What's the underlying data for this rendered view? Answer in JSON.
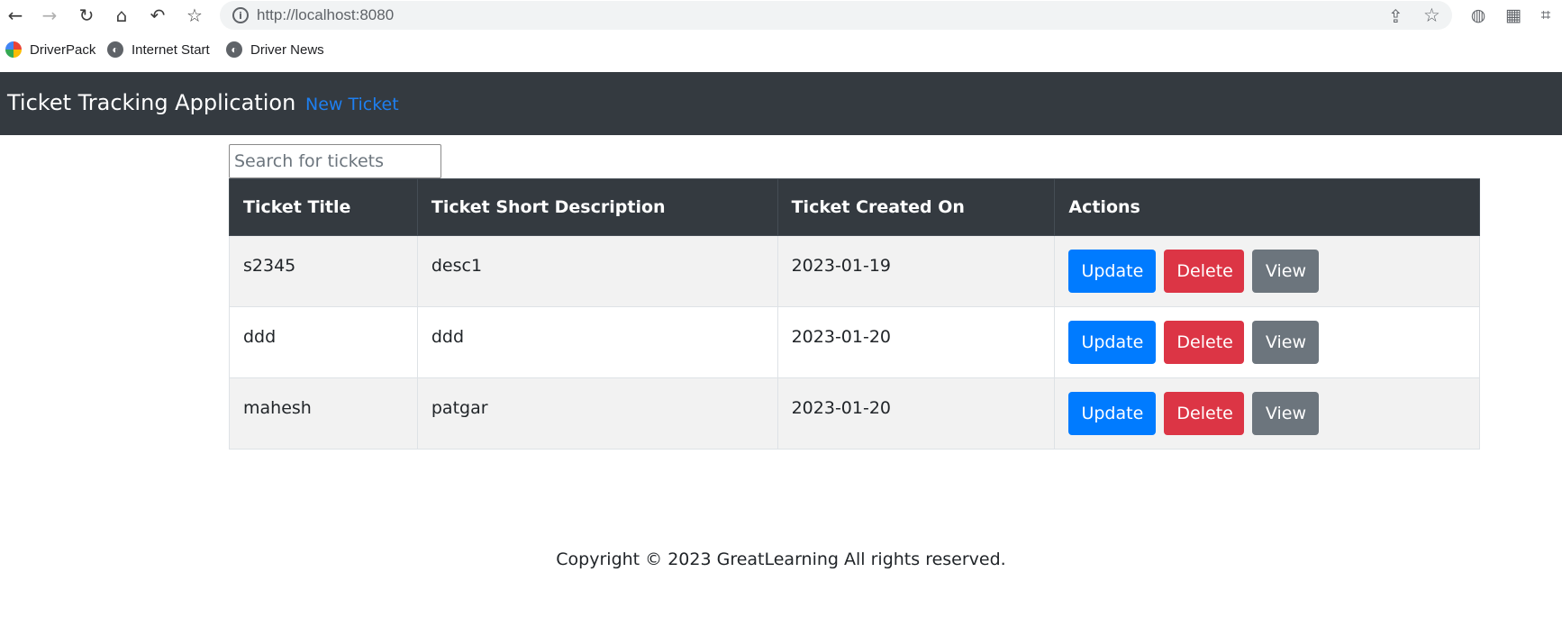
{
  "browser": {
    "url": "http://localhost:8080",
    "bookmarks": [
      "DriverPack",
      "Internet Start",
      "Driver News"
    ]
  },
  "navbar": {
    "brand": "Ticket Tracking Application",
    "new_ticket_link": "New Ticket"
  },
  "search": {
    "placeholder": "Search for tickets",
    "value": ""
  },
  "table": {
    "headers": [
      "Ticket Title",
      "Ticket Short Description",
      "Ticket Created On",
      "Actions"
    ],
    "rows": [
      {
        "title": "s2345",
        "description": "desc1",
        "created_on": "2023-01-19"
      },
      {
        "title": "ddd",
        "description": "ddd",
        "created_on": "2023-01-20"
      },
      {
        "title": "mahesh",
        "description": "patgar",
        "created_on": "2023-01-20"
      }
    ],
    "actions": {
      "update": "Update",
      "delete": "Delete",
      "view": "View"
    }
  },
  "footer": {
    "text": "Copyright © 2023 GreatLearning All rights reserved."
  },
  "colors": {
    "navbar_bg": "#343a40",
    "link": "#1e7ff0",
    "primary": "#007bff",
    "danger": "#dc3545",
    "secondary": "#6c757d"
  }
}
